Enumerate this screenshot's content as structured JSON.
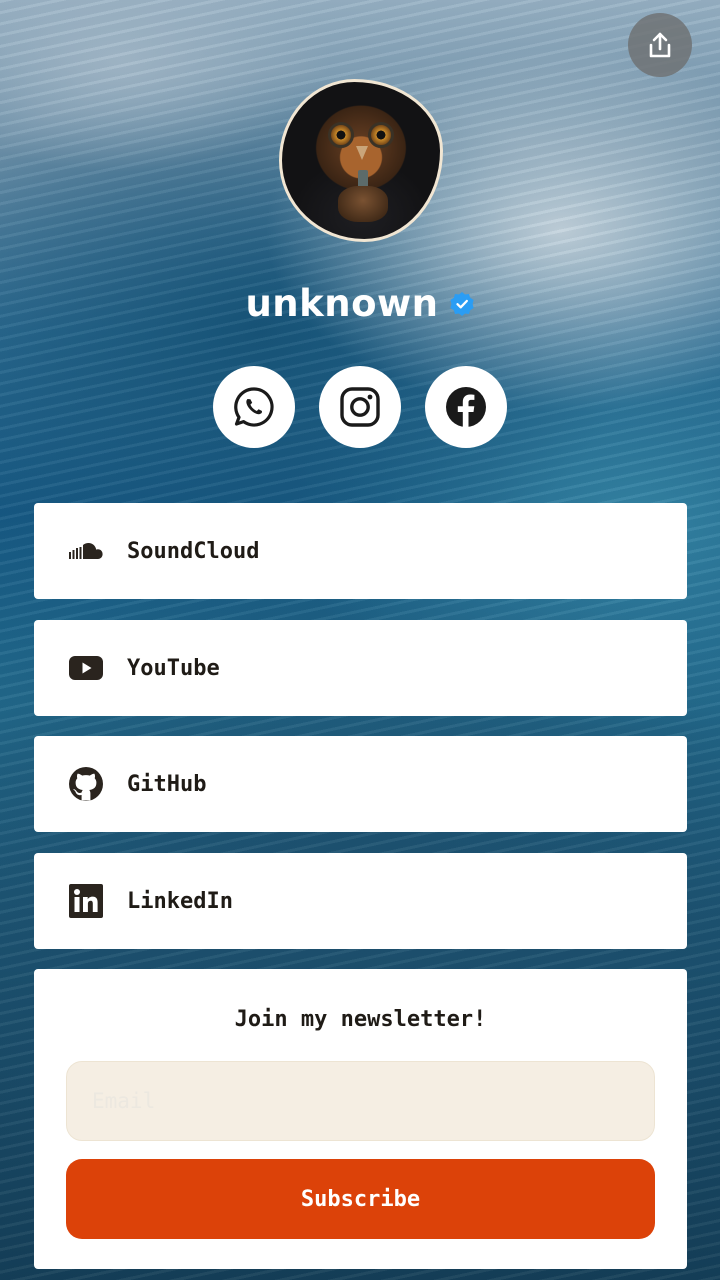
{
  "profile": {
    "name": "unknown",
    "verified_icon": "verified-badge-icon",
    "avatar": "owl-avatar"
  },
  "header": {
    "share_icon": "share-icon"
  },
  "socials": [
    {
      "name": "WhatsApp",
      "icon": "whatsapp-icon"
    },
    {
      "name": "Instagram",
      "icon": "instagram-icon"
    },
    {
      "name": "Facebook",
      "icon": "facebook-icon"
    }
  ],
  "links": [
    {
      "label": "SoundCloud",
      "icon": "soundcloud-icon"
    },
    {
      "label": "YouTube",
      "icon": "youtube-icon"
    },
    {
      "label": "GitHub",
      "icon": "github-icon"
    },
    {
      "label": "LinkedIn",
      "icon": "linkedin-icon"
    }
  ],
  "newsletter": {
    "title": "Join my newsletter!",
    "email_placeholder": "Email",
    "email_value": "",
    "subscribe_label": "Subscribe"
  },
  "colors": {
    "accent": "#dc4209",
    "card": "#ffffff",
    "input_bg": "#f5eee3",
    "verified": "#2a9df4",
    "text": "#1f1b16"
  }
}
